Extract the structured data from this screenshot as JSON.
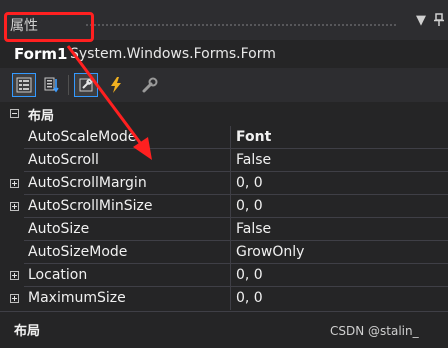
{
  "panel": {
    "title": "属性",
    "dropdown_glyph": "▼",
    "pin_glyph": "⊥",
    "highlight_color": "#ff2020"
  },
  "object": {
    "name": "Form1",
    "type": "System.Windows.Forms.Form"
  },
  "toolbar": {
    "buttons": [
      {
        "icon": "categorized-icon"
      },
      {
        "icon": "alphabetical-icon"
      },
      {
        "icon": "properties-icon",
        "active": true
      },
      {
        "icon": "events-icon"
      },
      {
        "icon": "property-pages-icon"
      }
    ]
  },
  "category": {
    "label": "布局"
  },
  "properties": [
    {
      "name": "AutoScaleMode",
      "value": "Font",
      "bold": true,
      "expandable": false
    },
    {
      "name": "AutoScroll",
      "value": "False",
      "expandable": false
    },
    {
      "name": "AutoScrollMargin",
      "value": "0, 0",
      "expandable": true
    },
    {
      "name": "AutoScrollMinSize",
      "value": "0, 0",
      "expandable": true
    },
    {
      "name": "AutoSize",
      "value": "False",
      "expandable": false
    },
    {
      "name": "AutoSizeMode",
      "value": "GrowOnly",
      "expandable": false
    },
    {
      "name": "Location",
      "value": "0, 0",
      "expandable": true
    },
    {
      "name": "MaximumSize",
      "value": "0, 0",
      "expandable": true
    }
  ],
  "description": {
    "title": "布局",
    "watermark": "CSDN @stalin_"
  }
}
